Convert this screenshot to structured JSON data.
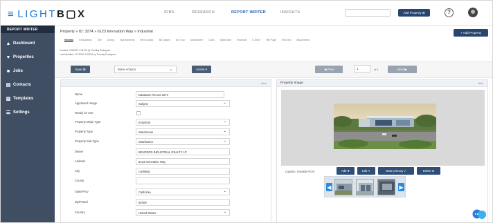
{
  "brand": {
    "logo_bars": "≡",
    "logo_light": "LIGHT",
    "logo_box": "B",
    "logo_o": "▢",
    "logo_x": "X",
    "accent": "#1f77c9",
    "sidebar_bg": "#3f4e63"
  },
  "topnav": {
    "items": [
      "JOBS",
      "RESEARCH",
      "REPORT WRITER",
      "INSIGHTS"
    ],
    "active_index": 2,
    "add_button": "Add Property ⊞",
    "help": "?"
  },
  "sidebar": {
    "header": "REPORT WRITER",
    "items": [
      {
        "label": "Dashboard",
        "icon": "car-icon",
        "glyph": "▲"
      },
      {
        "label": "Properties",
        "icon": "map-pin-icon",
        "glyph": "▼"
      },
      {
        "label": "Jobs",
        "icon": "briefcase-icon",
        "glyph": "■"
      },
      {
        "label": "Contacts",
        "icon": "contact-card-icon",
        "glyph": "▤"
      },
      {
        "label": "Templates",
        "icon": "document-icon",
        "glyph": "▥"
      },
      {
        "label": "Settings",
        "icon": "sliders-icon",
        "glyph": "☰"
      }
    ]
  },
  "header": {
    "breadcrumb": "Property » ID: 3274 » 6123 Innovation Way » Industrial",
    "add_property": "+ Add Property",
    "tabs": [
      "General",
      "Transactions",
      "Site",
      "Zoning",
      "Improvements",
      "Rent Leases",
      "Bill Leases",
      "Inc / Exp",
      "Assessment",
      "Costs",
      "Sales Sale",
      "Research",
      "E-Store",
      "Title Page",
      "Tens Info",
      "Attachments"
    ],
    "active_tab": 0,
    "created": "Created: 2/3/2022 1:31PM by Timothy Rodriguez",
    "modified": "Last Modified: 3/7/2022 4:31PM by Timothy Rodriguez"
  },
  "toolbar": {
    "save": "Save ⊞",
    "more_actions": "More Actions",
    "chevron": "⌄",
    "active": "Active ▾",
    "prev": "◀ Prev",
    "page_value": "1",
    "page_of": "of 1",
    "next": "Next ▶"
  },
  "form": {
    "panel_link": "Hide",
    "rows": [
      {
        "label": "Name",
        "value": "Database Record 3274",
        "type": "text"
      },
      {
        "label": "Appraised Usage",
        "value": "Subject",
        "type": "select"
      },
      {
        "label": "Ready for Use",
        "value": "",
        "type": "checkbox"
      },
      {
        "label": "Property Major Type",
        "value": "Industrial",
        "type": "select"
      },
      {
        "label": "Property Type",
        "value": "Warehouse",
        "type": "select"
      },
      {
        "label": "Property Sub-Type",
        "value": "Distribution",
        "type": "select"
      },
      {
        "label": "Owner",
        "value": "BENFORD INDUSTRIAL REALTY LP",
        "type": "text"
      },
      {
        "label": "Address",
        "value": "6123 Innovation Way",
        "type": "text"
      },
      {
        "label": "City",
        "value": "Carlsbad",
        "type": "text"
      },
      {
        "label": "County",
        "value": "",
        "type": "text"
      },
      {
        "label": "State/Prov",
        "value": "California",
        "type": "select"
      },
      {
        "label": "Zip/Postal",
        "value": "92009",
        "type": "text"
      },
      {
        "label": "Country",
        "value": "United States",
        "type": "select"
      }
    ]
  },
  "image_panel": {
    "title": "Property Image",
    "link": "Hide",
    "buttons": [
      "Add ✚",
      "Edit ✎",
      "Make primary ✔",
      "Delete ⊞"
    ],
    "caption": "Caption:   Outside Front",
    "prev_glyph": "◀",
    "next_glyph": "▶"
  }
}
